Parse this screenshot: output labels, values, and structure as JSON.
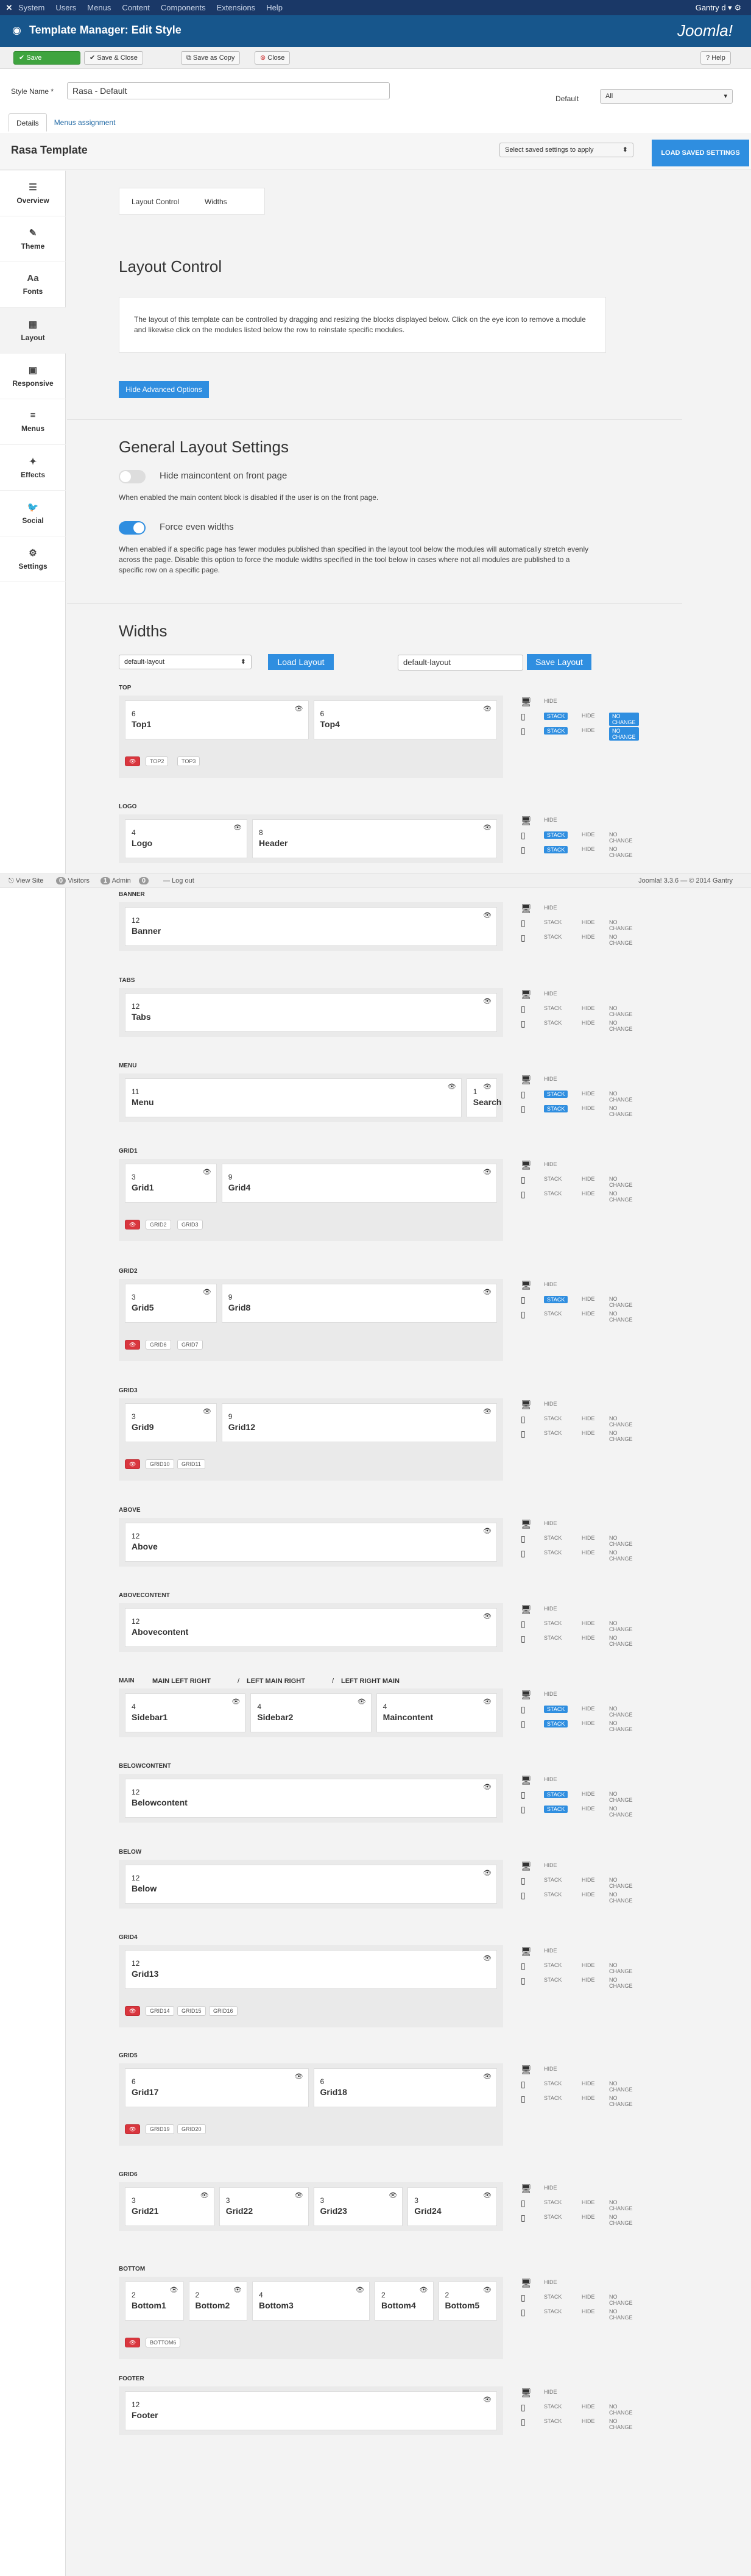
{
  "topmenu": {
    "items": [
      "System",
      "Users",
      "Menus",
      "Content",
      "Components",
      "Extensions",
      "Help"
    ],
    "user": "Gantry d ▾",
    "gear": "⚙"
  },
  "header": {
    "title": "Template Manager: Edit Style",
    "logo": "Joomla!"
  },
  "toolbar": {
    "save": "Save",
    "save_close": "Save & Close",
    "save_copy": "Save as Copy",
    "close": "Close",
    "help": "Help"
  },
  "form": {
    "style_label": "Style Name *",
    "style_value": "Rasa - Default",
    "default_label": "Default",
    "default_value": "All"
  },
  "tabs": [
    "Details",
    "Menus assignment"
  ],
  "template": {
    "name": "Rasa Template",
    "select_saved": "Select saved settings to apply",
    "load_saved": "LOAD SAVED SETTINGS"
  },
  "sidebar": [
    {
      "icon": "☰",
      "label": "Overview"
    },
    {
      "icon": "✎",
      "label": "Theme"
    },
    {
      "icon": "Aa",
      "label": "Fonts"
    },
    {
      "icon": "▦",
      "label": "Layout"
    },
    {
      "icon": "▣",
      "label": "Responsive"
    },
    {
      "icon": "≡",
      "label": "Menus"
    },
    {
      "icon": "✦",
      "label": "Effects"
    },
    {
      "icon": "🐦",
      "label": "Social"
    },
    {
      "icon": "⚙",
      "label": "Settings"
    }
  ],
  "subtabs": [
    "Layout Control",
    "Widths"
  ],
  "layout_control": {
    "title": "Layout Control",
    "desc": "The layout of this template can be controlled by dragging and resizing the blocks displayed below. Click on the eye icon to remove a module and likewise click on the modules listed below the row to reinstate specific modules.",
    "button": "Hide Advanced Options"
  },
  "general": {
    "title": "General Layout Settings",
    "hide_main": "Hide maincontent on front page",
    "hide_main_desc": "When enabled the main content block is disabled if the user is on the front page.",
    "force_even": "Force even widths",
    "force_even_desc": "When enabled if a specific page has fewer modules published than specified in the layout tool below the modules will automatically stretch evenly across the page. Disable this option to force the module widths specified in the tool below in cases where not all modules are published to a specific row on a specific page."
  },
  "widths": {
    "title": "Widths",
    "layout_select": "default-layout",
    "load": "Load Layout",
    "layout_name": "default-layout",
    "save": "Save Layout"
  },
  "ctrl": {
    "hide": "HIDE",
    "stack": "STACK",
    "nochange": "NO CHANGE"
  },
  "footer": {
    "view_site": "View Site",
    "visitors": "0",
    "visitors_label": "Visitors",
    "admin": "1",
    "admin_label": "Admin",
    "msgs": "0",
    "logout": "Log out",
    "right": "Joomla! 3.3.6 — © 2014 Gantry"
  },
  "rows": [
    {
      "title": "TOP",
      "mods": [
        [
          "6",
          "Top1"
        ],
        [
          "6",
          "Top4"
        ]
      ],
      "chips": [
        "TOP2",
        "TOP3"
      ]
    },
    {
      "title": "LOGO",
      "mods": [
        [
          "4",
          "Logo"
        ],
        [
          "8",
          "Header"
        ]
      ],
      "chips": []
    },
    {
      "title": "BANNER",
      "mods": [
        [
          "12",
          "Banner"
        ]
      ],
      "chips": []
    },
    {
      "title": "TABS",
      "mods": [
        [
          "12",
          "Tabs"
        ]
      ],
      "chips": []
    },
    {
      "title": "MENU",
      "mods": [
        [
          "11",
          "Menu"
        ],
        [
          "1",
          "Search"
        ]
      ],
      "chips": []
    },
    {
      "title": "GRID1",
      "mods": [
        [
          "3",
          "Grid1"
        ],
        [
          "9",
          "Grid4"
        ]
      ],
      "chips": [
        "GRID2",
        "GRID3"
      ]
    },
    {
      "title": "GRID2",
      "mods": [
        [
          "3",
          "Grid5"
        ],
        [
          "9",
          "Grid8"
        ]
      ],
      "chips": [
        "GRID6",
        "GRID7"
      ]
    },
    {
      "title": "GRID3",
      "mods": [
        [
          "3",
          "Grid9"
        ],
        [
          "9",
          "Grid12"
        ]
      ],
      "chips": [
        "GRID10",
        "GRID11"
      ]
    },
    {
      "title": "ABOVE",
      "mods": [
        [
          "12",
          "Above"
        ]
      ],
      "chips": []
    },
    {
      "title": "ABOVECONTENT",
      "mods": [
        [
          "12",
          "Abovecontent"
        ]
      ],
      "chips": []
    },
    {
      "title": "MAIN",
      "mods": [
        [
          "4",
          "Sidebar1"
        ],
        [
          "4",
          "Sidebar2"
        ],
        [
          "4",
          "Maincontent"
        ]
      ],
      "chips": [],
      "extra": [
        "MAIN LEFT RIGHT",
        "LEFT MAIN RIGHT",
        "LEFT RIGHT MAIN"
      ]
    },
    {
      "title": "BELOWCONTENT",
      "mods": [
        [
          "12",
          "Belowcontent"
        ]
      ],
      "chips": []
    },
    {
      "title": "BELOW",
      "mods": [
        [
          "12",
          "Below"
        ]
      ],
      "chips": []
    },
    {
      "title": "GRID4",
      "mods": [
        [
          "12",
          "Grid13"
        ]
      ],
      "chips": [
        "GRID14",
        "GRID15",
        "GRID16"
      ]
    },
    {
      "title": "GRID5",
      "mods": [
        [
          "6",
          "Grid17"
        ],
        [
          "6",
          "Grid18"
        ]
      ],
      "chips": [
        "GRID19",
        "GRID20"
      ]
    },
    {
      "title": "GRID6",
      "mods": [
        [
          "3",
          "Grid21"
        ],
        [
          "3",
          "Grid22"
        ],
        [
          "3",
          "Grid23"
        ],
        [
          "3",
          "Grid24"
        ]
      ],
      "chips": []
    },
    {
      "title": "BOTTOM",
      "mods": [
        [
          "2",
          "Bottom1"
        ],
        [
          "2",
          "Bottom2"
        ],
        [
          "4",
          "Bottom3"
        ],
        [
          "2",
          "Bottom4"
        ],
        [
          "2",
          "Bottom5"
        ]
      ],
      "chips": [
        "BOTTOM6"
      ]
    },
    {
      "title": "FOOTER",
      "mods": [
        [
          "12",
          "Footer"
        ]
      ],
      "chips": []
    }
  ]
}
